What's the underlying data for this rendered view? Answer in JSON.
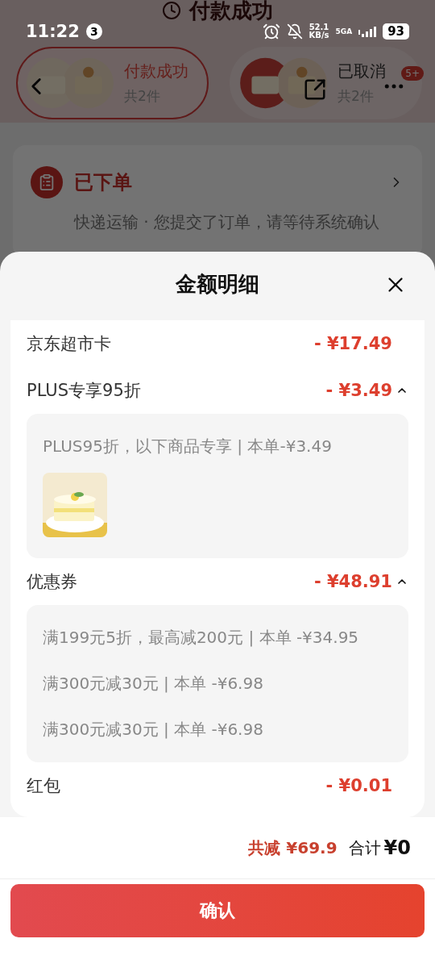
{
  "status_bar": {
    "time": "11:22",
    "notification_count": "3",
    "speed": "52.1",
    "speed_unit": "KB/s",
    "network": "5GA",
    "battery": "93"
  },
  "background": {
    "title": "付款成功",
    "order_tabs": [
      {
        "status": "付款成功",
        "count": "共2件",
        "selected": true
      },
      {
        "status": "已取消",
        "count": "共2件",
        "selected": false
      }
    ],
    "badge": "5+",
    "progress": {
      "title": "已下单",
      "text": "快递运输 · 您提交了订单，请等待系统确认"
    }
  },
  "sheet": {
    "title": "金额明细",
    "rows": [
      {
        "label": "京东超市卡",
        "amount": "- ¥17.49"
      },
      {
        "label": "PLUS专享95折",
        "amount": "- ¥3.49",
        "expanded": true,
        "details": [
          "PLUS95折，以下商品专享 | 本单-¥3.49"
        ],
        "products": [
          {
            "kind": "picture"
          }
        ]
      },
      {
        "label": "优惠券",
        "amount": "- ¥48.91",
        "expanded": true,
        "details": [
          "满199元5折，最高减200元 | 本单 -¥34.95",
          "满300元减30元 | 本单 -¥6.98",
          "满300元减30元 | 本单 -¥6.98"
        ]
      },
      {
        "label": "红包",
        "amount": "- ¥0.01"
      }
    ],
    "discount_total": "共减 ¥69.9",
    "total_label": "合计",
    "total": "¥0",
    "confirm": "确认"
  }
}
